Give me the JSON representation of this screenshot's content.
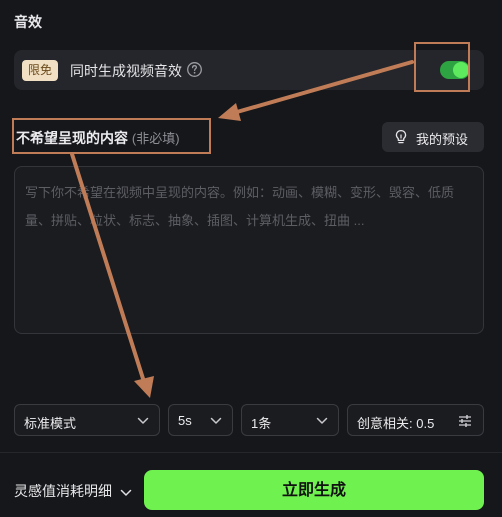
{
  "sound_section": {
    "title": "音效",
    "badge": "限免",
    "label": "同时生成视频音效",
    "toggle_on": true
  },
  "negative_prompt": {
    "title": "不希望呈现的内容",
    "optional_hint": "(非必填)",
    "preset_label": "我的预设",
    "placeholder": "写下你不希望在视频中呈现的内容。例如：动画、模糊、变形、毁容、低质量、拼贴、粒状、标志、抽象、插图、计算机生成、扭曲 ...",
    "value": ""
  },
  "options": {
    "mode": "标准模式",
    "duration": "5s",
    "count": "1条",
    "creativity": "创意相关: 0.5"
  },
  "footer": {
    "cost_label": "灵感值消耗明细",
    "generate_label": "立即生成"
  },
  "colors": {
    "accent_green": "#6ff14f",
    "toggle_green": "#2ea342",
    "annotation": "#c07c56"
  }
}
